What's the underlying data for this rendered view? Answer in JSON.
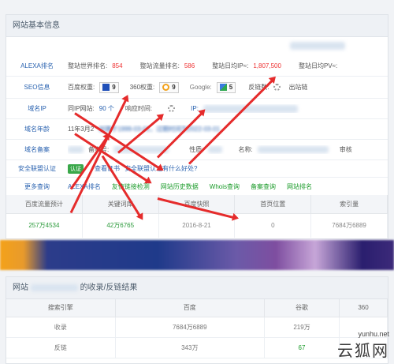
{
  "info": {
    "title": "网站基本信息",
    "alexa": {
      "label": "ALEXA排名",
      "world_label": "整站世界排名:",
      "world_value": "854",
      "traffic_label": "整站流量排名:",
      "traffic_value": "586",
      "ip_label": "整站日均IP≈:",
      "ip_value": "1,807,500",
      "pv_label": "整站日均PV≈:"
    },
    "seo": {
      "label": "SEO信息",
      "baidu_label": "百度权重:",
      "baidu_value": "9",
      "s360_label": "360权重:",
      "s360_value": "9",
      "google_label": "Google:",
      "google_value": "5",
      "backlinks_label": "反链数:",
      "outlinks_label": "出站链"
    },
    "ip": {
      "label": "域名IP",
      "same_ip_label": "同IP网站:",
      "same_ip_value": "90 个",
      "response_label": "响应时间:",
      "ip_field_label": "IP:"
    },
    "age": {
      "label": "域名年龄",
      "prefix": "11年3月2",
      "dates_blurred": "创建于1999-03-01，过期时间为2022-03-01"
    },
    "icp": {
      "label": "域名备案",
      "record_label": "备案号:",
      "nature_label": "性质:",
      "name_label": "名称:",
      "audit_label": "审核"
    },
    "security": {
      "label": "安全联盟认证",
      "badge": "认证",
      "view_cert": "查看证书",
      "what_is": "安全联盟认证有什么好处?"
    },
    "more": {
      "label": "更多查询",
      "links": [
        "ALEXA排名",
        "友情链接检测",
        "网站历史数据",
        "Whois查询",
        "备案查询",
        "网站排名"
      ]
    },
    "stats": {
      "headers": [
        "百度流量预计",
        "关键词库",
        "百度快照",
        "首页位置",
        "索引量"
      ],
      "values": [
        "257万4534",
        "42万6765",
        "2016-8-21",
        "0",
        "7684万6889"
      ]
    }
  },
  "backlinks": {
    "title_prefix": "网站",
    "title_suffix": "的收录/反链结果",
    "headers": [
      "搜索引擎",
      "百度",
      "谷歌",
      "360"
    ],
    "rows": [
      {
        "engine": "收录",
        "baidu": "7684万6889",
        "google": "219万",
        "s360": ""
      },
      {
        "engine": "反链",
        "baidu": "343万",
        "google": "67",
        "s360": ""
      }
    ]
  },
  "watermark": {
    "url": "yunhu.net",
    "brand": "云狐网"
  },
  "colors": {
    "label_blue": "#2b63b0",
    "value_red": "#e33333",
    "value_green": "#1b9b2a",
    "arrow_red": "#e52b2b"
  }
}
